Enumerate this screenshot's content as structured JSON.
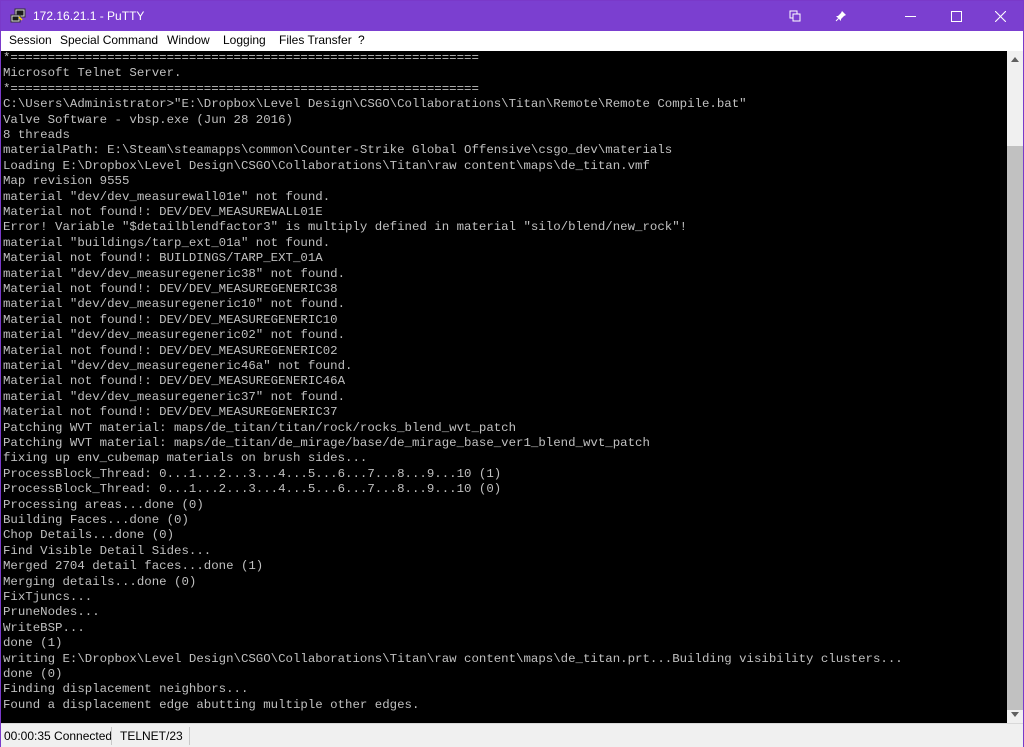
{
  "window": {
    "title": "172.16.21.1 - PuTTY",
    "controls": {
      "minimize": "—",
      "maximize": "☐",
      "close": "✕"
    }
  },
  "menu": {
    "items": [
      "Session",
      "Special Command",
      "Window",
      "Logging",
      "Files Transfer",
      "?"
    ]
  },
  "terminal": {
    "fg_color": "#c0c0c0",
    "bg_color": "#000000",
    "lines": [
      "*===============================================================",
      "Microsoft Telnet Server.",
      "*===============================================================",
      "C:\\Users\\Administrator>\"E:\\Dropbox\\Level Design\\CSGO\\Collaborations\\Titan\\Remote\\Remote Compile.bat\"",
      "Valve Software - vbsp.exe (Jun 28 2016)",
      "8 threads",
      "materialPath: E:\\Steam\\steamapps\\common\\Counter-Strike Global Offensive\\csgo_dev\\materials",
      "Loading E:\\Dropbox\\Level Design\\CSGO\\Collaborations\\Titan\\raw content\\maps\\de_titan.vmf",
      "Map revision 9555",
      "material \"dev/dev_measurewall01e\" not found.",
      "Material not found!: DEV/DEV_MEASUREWALL01E",
      "Error! Variable \"$detailblendfactor3\" is multiply defined in material \"silo/blend/new_rock\"!",
      "material \"buildings/tarp_ext_01a\" not found.",
      "Material not found!: BUILDINGS/TARP_EXT_01A",
      "material \"dev/dev_measuregeneric38\" not found.",
      "Material not found!: DEV/DEV_MEASUREGENERIC38",
      "material \"dev/dev_measuregeneric10\" not found.",
      "Material not found!: DEV/DEV_MEASUREGENERIC10",
      "material \"dev/dev_measuregeneric02\" not found.",
      "Material not found!: DEV/DEV_MEASUREGENERIC02",
      "material \"dev/dev_measuregeneric46a\" not found.",
      "Material not found!: DEV/DEV_MEASUREGENERIC46A",
      "material \"dev/dev_measuregeneric37\" not found.",
      "Material not found!: DEV/DEV_MEASUREGENERIC37",
      "Patching WVT material: maps/de_titan/titan/rock/rocks_blend_wvt_patch",
      "Patching WVT material: maps/de_titan/de_mirage/base/de_mirage_base_ver1_blend_wvt_patch",
      "fixing up env_cubemap materials on brush sides...",
      "ProcessBlock_Thread: 0...1...2...3...4...5...6...7...8...9...10 (1)",
      "ProcessBlock_Thread: 0...1...2...3...4...5...6...7...8...9...10 (0)",
      "Processing areas...done (0)",
      "Building Faces...done (0)",
      "Chop Details...done (0)",
      "Find Visible Detail Sides...",
      "Merged 2704 detail faces...done (1)",
      "Merging details...done (0)",
      "FixTjuncs...",
      "PruneNodes...",
      "WriteBSP...",
      "done (1)",
      "writing E:\\Dropbox\\Level Design\\CSGO\\Collaborations\\Titan\\raw content\\maps\\de_titan.prt...Building visibility clusters...",
      "done (0)",
      "Finding displacement neighbors...",
      "Found a displacement edge abutting multiple other edges."
    ]
  },
  "status": {
    "connection": "00:00:35 Connected",
    "protocol": "TELNET/23"
  },
  "colors": {
    "titlebar": "#7b3fd0",
    "terminal_bg": "#000000",
    "terminal_fg": "#c0c0c0"
  }
}
